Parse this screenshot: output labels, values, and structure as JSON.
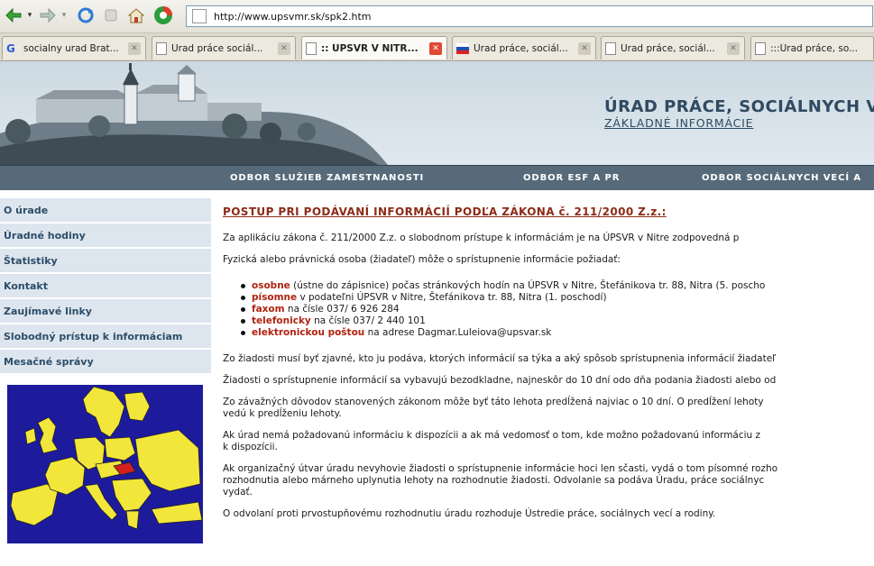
{
  "browser": {
    "url": "http://www.upsvmr.sk/spk2.htm",
    "tabs": [
      {
        "label": "socialny urad Brat...",
        "icon": "google-favicon"
      },
      {
        "label": "Úrad práce sociál...",
        "icon": "page-icon"
      },
      {
        "label": ":: ÚPSVR V NITR...",
        "icon": "page-icon",
        "active": true
      },
      {
        "label": "Úrad práce, sociál...",
        "icon": "slovak-flag-icon"
      },
      {
        "label": "Úrad práce, sociál...",
        "icon": "page-icon"
      },
      {
        "label": ":::Úrad práce, so...",
        "icon": "page-icon"
      }
    ]
  },
  "header": {
    "title": "ÚRAD PRÁCE, SOCIÁLNYCH V",
    "subtitle": "ZÁKLADNÉ INFORMÁCIE"
  },
  "nav": [
    "ODBOR SLUŽIEB ZAMESTNANOSTI",
    "ODBOR ESF A PR",
    "ODBOR SOCIÁLNYCH VECÍ A"
  ],
  "sidebar": [
    "O úrade",
    "Úradné hodiny",
    "Štatistiky",
    "Kontakt",
    "Zaujímavé linky",
    "Slobodný prístup k informáciam",
    "Mesačné správy"
  ],
  "content": {
    "title": "POSTUP PRI PODÁVANÍ INFORMÁCIÍ PODĽA ZÁKONA č. 211/2000 Z.z.:",
    "p1": "Za aplikáciu zákona č. 211/2000 Z.z. o slobodnom prístupe k informáciám je na ÚPSVR v Nitre zodpovedná p",
    "p2": "Fyzická alebo právnická osoba (žiadateľ) môže o sprístupnenie informácie požiadať:",
    "bullets": [
      {
        "hl": "osobne",
        "text": " (ústne do zápisnice) počas stránkových hodín na ÚPSVR v Nitre, Štefánikova tr. 88, Nitra (5. poscho"
      },
      {
        "hl": "písomne",
        "text": " v podateľni ÚPSVR v Nitre, Štefánikova tr. 88, Nitra (1. poschodí)"
      },
      {
        "hl": "faxom",
        "text": " na čísle 037/ 6 926 284"
      },
      {
        "hl": "telefonicky",
        "text": " na čísle 037/ 2 440 101"
      },
      {
        "hl": "elektronickou poštou",
        "text": " na adrese Dagmar.Luleiova@upsvar.sk"
      }
    ],
    "p3": "Zo žiadosti musí byť zjavné, kto ju podáva, ktorých informácií sa týka a aký spôsob sprístupnenia informácií žiadateľ",
    "p4": "Žiadosti o sprístupnenie informácií sa vybavujú bezodkladne, najneskôr do 10 dní odo dňa podania žiadosti alebo od",
    "p5a": "Zo závažných dôvodov  stanovených zákonom môže byť táto lehota predĺžená najviac o 10 dní.  O predĺžení lehoty",
    "p5b": "vedú k  predĺženiu lehoty.",
    "p6a": "Ak úrad nemá požadovanú informáciu k  dispozícii a ak má vedomosť o tom, kde možno požadovanú informáciu z",
    "p6b": "k dispozícii.",
    "p7a": "Ak organizačný útvar úradu nevyhovie žiadosti o sprístupnenie informácie hoci len sčasti, vydá o  tom písomné rozho",
    "p7b": "rozhodnutia alebo márneho uplynutia lehoty na  rozhodnutie žiadosti. Odvolanie sa podáva Úradu, práce sociálnyc",
    "p7c": "vydať.",
    "p8": "O odvolaní proti prvostupňovému rozhodnutiu úradu rozhoduje Ústredie práce, sociálnych vecí a rodiny."
  }
}
